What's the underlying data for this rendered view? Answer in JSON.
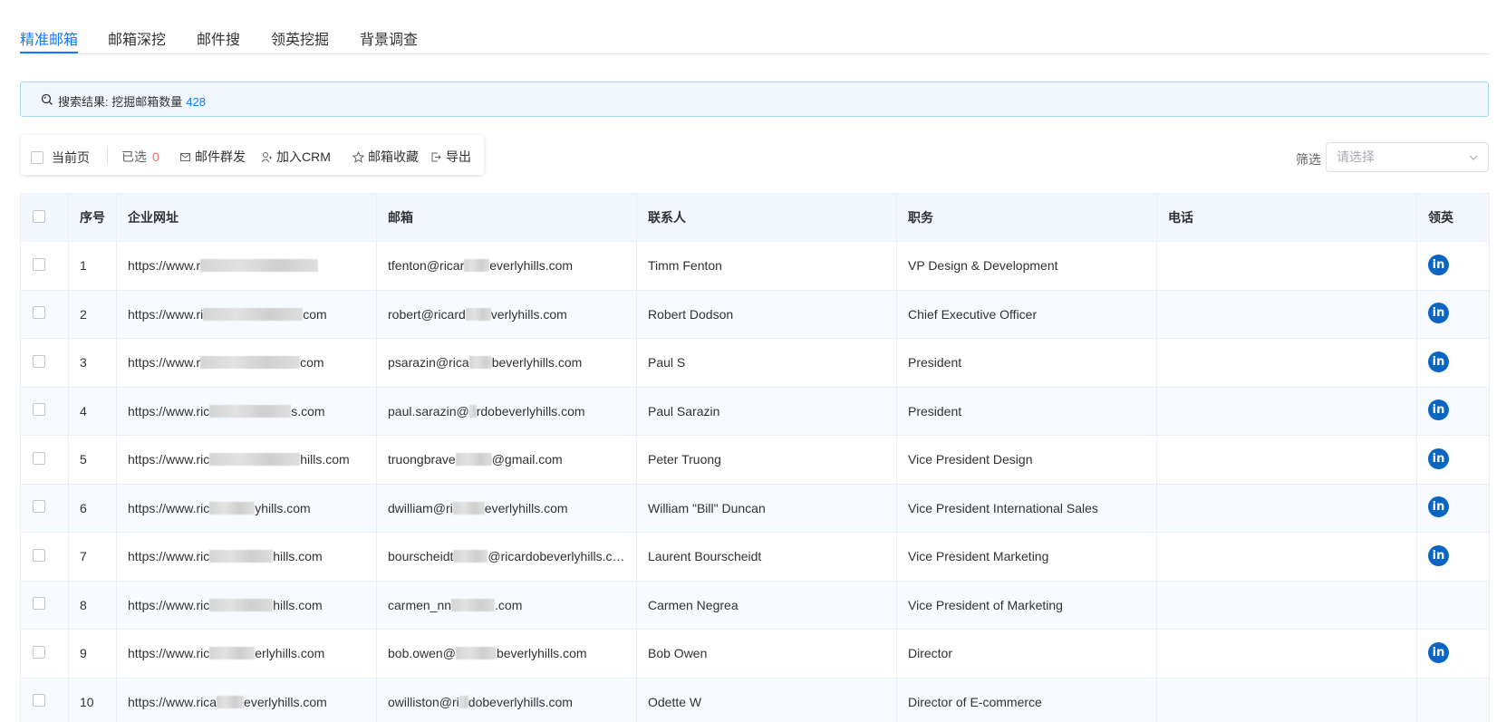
{
  "tabs": [
    {
      "label": "精准邮箱",
      "active": true
    },
    {
      "label": "邮箱深挖",
      "active": false
    },
    {
      "label": "邮件搜",
      "active": false
    },
    {
      "label": "领英挖掘",
      "active": false
    },
    {
      "label": "背景调查",
      "active": false
    }
  ],
  "banner": {
    "label": "搜索结果: 挖掘邮箱数量",
    "count": "428"
  },
  "toolbar": {
    "current_page": "当前页",
    "selected_label": "已选",
    "selected_count": "0",
    "mass_mail": "邮件群发",
    "add_crm": "加入CRM",
    "favorite": "邮箱收藏",
    "export": "导出"
  },
  "filter": {
    "label": "筛选",
    "placeholder": "请选择"
  },
  "table": {
    "headers": {
      "index": "序号",
      "website": "企业网址",
      "email": "邮箱",
      "contact": "联系人",
      "title": "职务",
      "phone": "电话",
      "linkedin": "领英"
    },
    "rows": [
      {
        "index": "1",
        "website_a": "https://www.r",
        "website_b": "",
        "email_a": "tfenton@ricar",
        "email_b": "everlyhills.com",
        "contact": "Timm Fenton",
        "title": "VP Design & Development",
        "phone": "",
        "linkedin": true
      },
      {
        "index": "2",
        "website_a": "https://www.ri",
        "website_b": "com",
        "email_a": "robert@ricard",
        "email_b": "verlyhills.com",
        "contact": "Robert Dodson",
        "title": "Chief Executive Officer",
        "phone": "",
        "linkedin": true
      },
      {
        "index": "3",
        "website_a": "https://www.r",
        "website_b": "com",
        "email_a": "psarazin@rica",
        "email_b": "beverlyhills.com",
        "contact": "Paul S",
        "title": "President",
        "phone": "",
        "linkedin": true
      },
      {
        "index": "4",
        "website_a": "https://www.ric",
        "website_b": "s.com",
        "email_a": "paul.sarazin@",
        "email_b": "rdobeverlyhills.com",
        "contact": "Paul Sarazin",
        "title": "President",
        "phone": "",
        "linkedin": true
      },
      {
        "index": "5",
        "website_a": "https://www.ric",
        "website_b": "hills.com",
        "email_a": "truongbrave",
        "email_b": "@gmail.com",
        "contact": "Peter Truong",
        "title": "Vice President Design",
        "phone": "",
        "linkedin": true
      },
      {
        "index": "6",
        "website_a": "https://www.ric",
        "website_b": "yhills.com",
        "email_a": "dwilliam@ri",
        "email_b": "everlyhills.com",
        "contact": "William \"Bill\" Duncan",
        "title": "Vice President International Sales",
        "phone": "",
        "linkedin": true
      },
      {
        "index": "7",
        "website_a": "https://www.ric",
        "website_b": "hills.com",
        "email_a": "bourscheidt",
        "email_b": "@ricardobeverlyhills.com",
        "contact": "Laurent Bourscheidt",
        "title": "Vice President Marketing",
        "phone": "",
        "linkedin": true
      },
      {
        "index": "8",
        "website_a": "https://www.ric",
        "website_b": "hills.com",
        "email_a": "carmen_nn",
        "email_b": ".com",
        "contact": "Carmen Negrea",
        "title": "Vice President of Marketing",
        "phone": "",
        "linkedin": false
      },
      {
        "index": "9",
        "website_a": "https://www.ric",
        "website_b": "erlyhills.com",
        "email_a": "bob.owen@",
        "email_b": "beverlyhills.com",
        "contact": "Bob Owen",
        "title": "Director",
        "phone": "",
        "linkedin": true
      },
      {
        "index": "10",
        "website_a": "https://www.rica",
        "website_b": "everlyhills.com",
        "email_a": "owilliston@ri",
        "email_b": "dobeverlyhills.com",
        "contact": "Odette W",
        "title": "Director of E-commerce",
        "phone": "",
        "linkedin": false
      }
    ]
  },
  "colors": {
    "accent": "#1677ff",
    "danger": "#f56c6c",
    "linkedin": "#0a66c2"
  }
}
